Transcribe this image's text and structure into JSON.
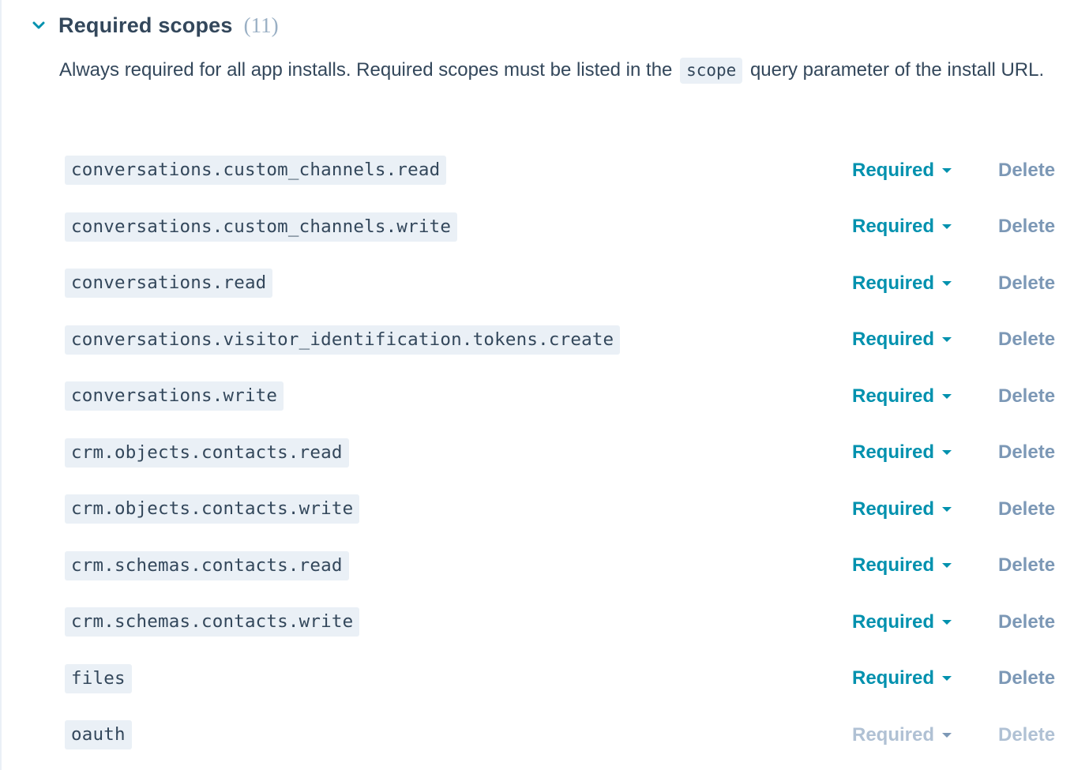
{
  "section": {
    "title": "Required scopes",
    "count": "(11)",
    "description_before": "Always required for all app installs. Required scopes must be listed in the",
    "description_code": "scope",
    "description_after": "query parameter of the install URL.",
    "collapse_icon": "chevron-down-icon"
  },
  "colors": {
    "accent": "#0091ae",
    "text": "#33475b",
    "muted": "#7c98b6",
    "code_bg": "#eaf0f6"
  },
  "scopes": [
    {
      "name": "conversations.custom_channels.read",
      "status": "Required",
      "delete_label": "Delete",
      "disabled": false
    },
    {
      "name": "conversations.custom_channels.write",
      "status": "Required",
      "delete_label": "Delete",
      "disabled": false
    },
    {
      "name": "conversations.read",
      "status": "Required",
      "delete_label": "Delete",
      "disabled": false
    },
    {
      "name": "conversations.visitor_identification.tokens.create",
      "status": "Required",
      "delete_label": "Delete",
      "disabled": false
    },
    {
      "name": "conversations.write",
      "status": "Required",
      "delete_label": "Delete",
      "disabled": false
    },
    {
      "name": "crm.objects.contacts.read",
      "status": "Required",
      "delete_label": "Delete",
      "disabled": false
    },
    {
      "name": "crm.objects.contacts.write",
      "status": "Required",
      "delete_label": "Delete",
      "disabled": false
    },
    {
      "name": "crm.schemas.contacts.read",
      "status": "Required",
      "delete_label": "Delete",
      "disabled": false
    },
    {
      "name": "crm.schemas.contacts.write",
      "status": "Required",
      "delete_label": "Delete",
      "disabled": false
    },
    {
      "name": "files",
      "status": "Required",
      "delete_label": "Delete",
      "disabled": false
    },
    {
      "name": "oauth",
      "status": "Required",
      "delete_label": "Delete",
      "disabled": true
    }
  ]
}
